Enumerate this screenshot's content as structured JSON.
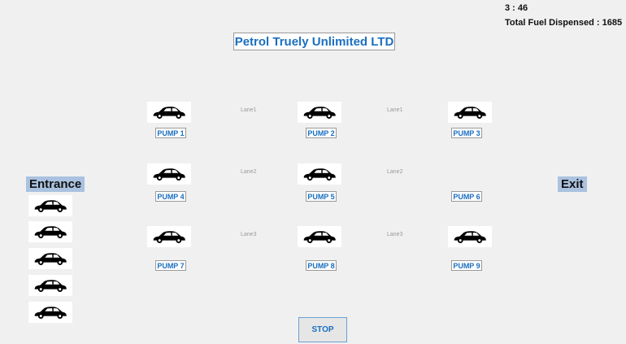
{
  "header": {
    "timer": "3 : 46",
    "total_fuel": "Total Fuel Dispensed : 1685",
    "title": "Petrol Truely Unlimited LTD"
  },
  "pumps": [
    "PUMP 1",
    "PUMP 2",
    "PUMP 3",
    "PUMP 4",
    "PUMP 5",
    "PUMP 6",
    "PUMP 7",
    "PUMP 8",
    "PUMP 9"
  ],
  "lanes": [
    "Lane1",
    "Lane1",
    "Lane2",
    "Lane2",
    "Lane3",
    "Lane3"
  ],
  "entrance_label": "Entrance",
  "exit_label": "Exit",
  "stop_label": "STOP",
  "icons": {
    "car": "car-icon"
  },
  "colors": {
    "accent": "#1a6fc0",
    "label_bg": "#aac2e0",
    "background": "#f0f0f0"
  }
}
